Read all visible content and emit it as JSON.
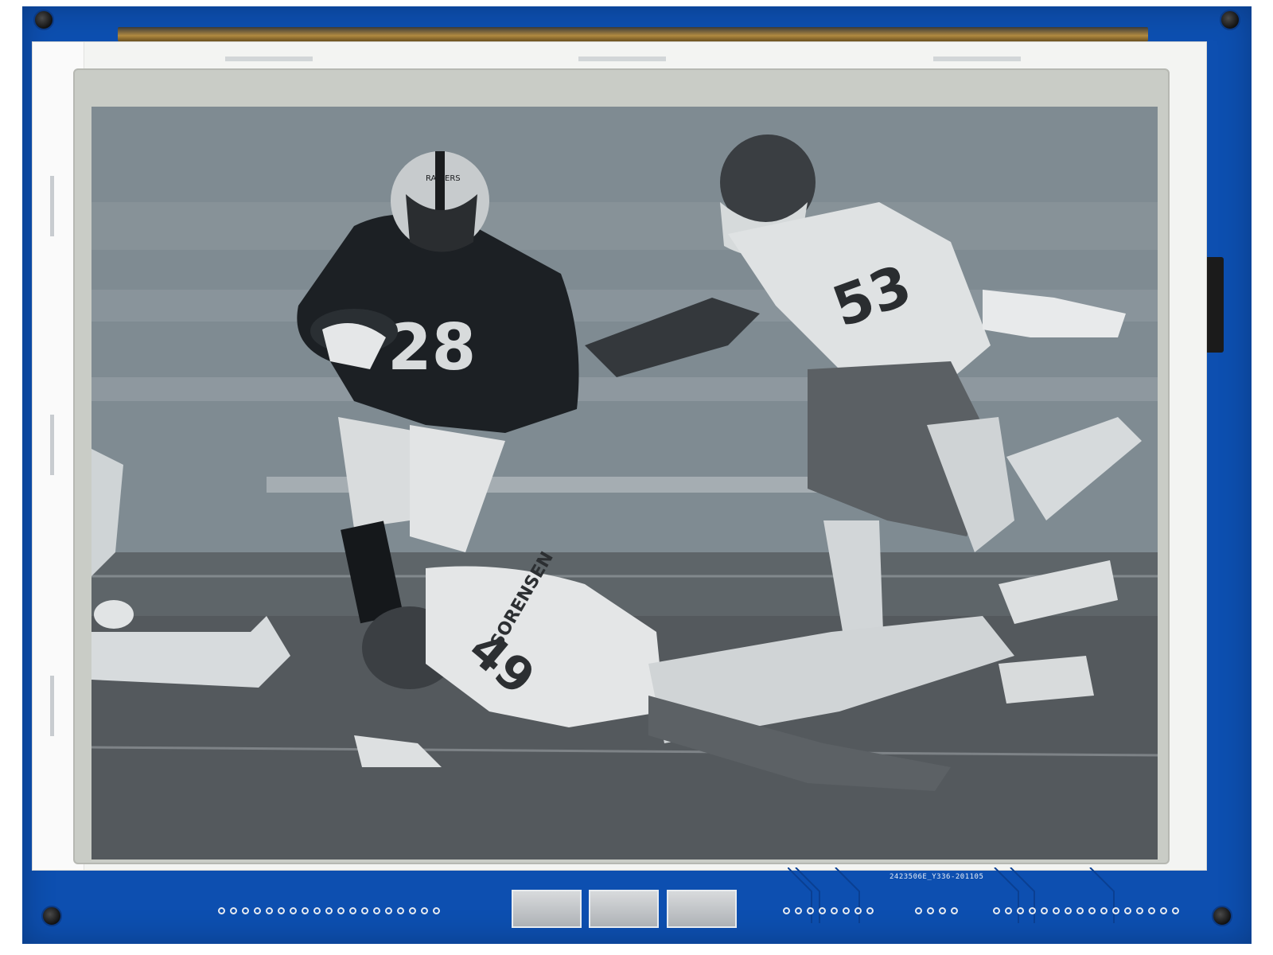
{
  "board": {
    "serial_text": "2423506E_Y336-201105",
    "colors": {
      "pcb": "#0d4fb0",
      "frame": "#f3f4f2",
      "screen_bg": "#7e8a91"
    }
  },
  "photo": {
    "scene": "football-tackle-photo",
    "jersey_runner": "28",
    "jersey_defender_right": "53",
    "jersey_defender_ground": "49",
    "name_on_ground_jersey": "SORENSEN",
    "helmet_text": "RAIDERS"
  },
  "connectors": {
    "left_pad_count": 19,
    "middle_pad_count": 8,
    "small_pad_count": 4,
    "right_pad_count": 16,
    "blocks": 3
  }
}
